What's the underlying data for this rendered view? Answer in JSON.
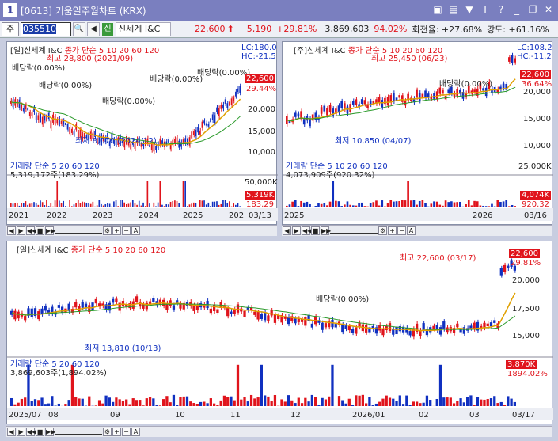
{
  "window": {
    "title": "[0613] 키움일주월차트 (KRX)",
    "icons": [
      "document-icon",
      "lock-icon",
      "pin-icon",
      "text-icon",
      "help-icon",
      "minimize-icon",
      "restore-icon",
      "close-icon"
    ]
  },
  "toolbar": {
    "market": "주",
    "code": "035510",
    "stock": "신세계 I&C",
    "price": "22,600",
    "change": "5,190",
    "pct": "+29.81%",
    "volume": "3,869,603",
    "vol_ratio": "94.02%",
    "turnover": "회전율: +27.68%",
    "strength": "강도: +61.16%"
  },
  "day_chart": {
    "title": "[일]신세계 I&C",
    "ma": "종가 단순 5  10  20  60  120",
    "lc": "LC:180.0",
    "hc": "HC:-21.5",
    "high": "최고 28,800 (2021/09)",
    "low": "최저 8,070 (2024/12)",
    "div_labels": [
      "배당락(0.00%)",
      "배당락(0.00%)",
      "배당락(0.00%)",
      "배당락(0.00%)",
      "배당락(0.00%)"
    ],
    "yticks": [
      "22,600",
      "20,000",
      "15,000",
      "10,000"
    ],
    "pct": "29.44%",
    "vol_title": "거래량  단순 5  20  60  120",
    "vol_val": "5,319,172주(183.29%)",
    "vol_tag": "5,319K",
    "vol_pct": "183.29",
    "vol_ytick": "50,000K",
    "xlabels": [
      "2021",
      "2022",
      "2023",
      "2024",
      "2025",
      "202"
    ],
    "xdate": "03/13"
  },
  "week_chart": {
    "title": "[주]신세계 I&C",
    "ma": "종가 단순 5  10  20  60  120",
    "lc": "LC:108.2",
    "hc": "HC:-11.2",
    "high": "최고 25,450 (06/23)",
    "low": "최저 10,850 (04/07)",
    "div_label": "배당락(0.00%)",
    "yticks": [
      "22,600",
      "20,000",
      "15,000",
      "10,000"
    ],
    "pct": "36.64%",
    "vol_title": "거래량  단순 5  10  20  60  120",
    "vol_val": "4,073,909주(920.32%)",
    "vol_tag": "4,074K",
    "vol_pct": "920.32",
    "vol_ytick": "25,000K",
    "xlabels": [
      "2025",
      "2026"
    ],
    "xdate": "03/16"
  },
  "main_chart": {
    "title": "[일]신세계 I&C",
    "ma": "종가 단순 5  10  20  60  120",
    "high": "최고 22,600 (03/17)",
    "low": "최저 13,810 (10/13)",
    "div_label": "배당락(0.00%)",
    "pct": "29.81%",
    "yticks": [
      "22,600",
      "20,000",
      "17,500",
      "15,000"
    ],
    "vol_title": "거래량  단순 5  20  60  120",
    "vol_val": "3,869,603주(1,894.02%)",
    "vol_tag": "3,870K",
    "vol_pct": "1894.02%",
    "xlabels": [
      "2025/07",
      "08",
      "09",
      "10",
      "11",
      "12",
      "2026/01",
      "02",
      "03"
    ],
    "xdate": "03/17"
  }
}
